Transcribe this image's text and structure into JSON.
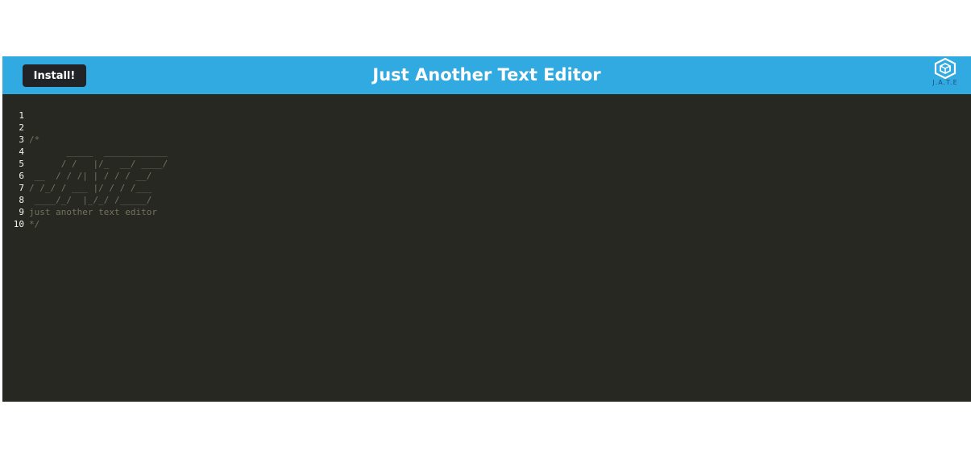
{
  "navbar": {
    "install_label": "Install!",
    "title": "Just Another Text Editor",
    "logo_icon": "cube-logo-icon",
    "logo_text": "J.A.T.E"
  },
  "colors": {
    "navbar_bg": "#31a9e1",
    "editor_bg": "#272822",
    "comment": "#75715e"
  },
  "editor": {
    "lines": [
      {
        "number": "1",
        "text": ""
      },
      {
        "number": "2",
        "text": "/*"
      },
      {
        "number": "3",
        "text": "       _____  ____________"
      },
      {
        "number": "4",
        "text": "      / /   |/_  __/ ____/"
      },
      {
        "number": "5",
        "text": " __  / / /| | / / / __/"
      },
      {
        "number": "6",
        "text": "/ /_/ / ___ |/ / / /___"
      },
      {
        "number": "7",
        "text": " ____/_/  |_/_/ /_____/"
      },
      {
        "number": "8",
        "text": "just another text editor"
      },
      {
        "number": "9",
        "text": "*/"
      },
      {
        "number": "10",
        "text": ""
      }
    ]
  }
}
